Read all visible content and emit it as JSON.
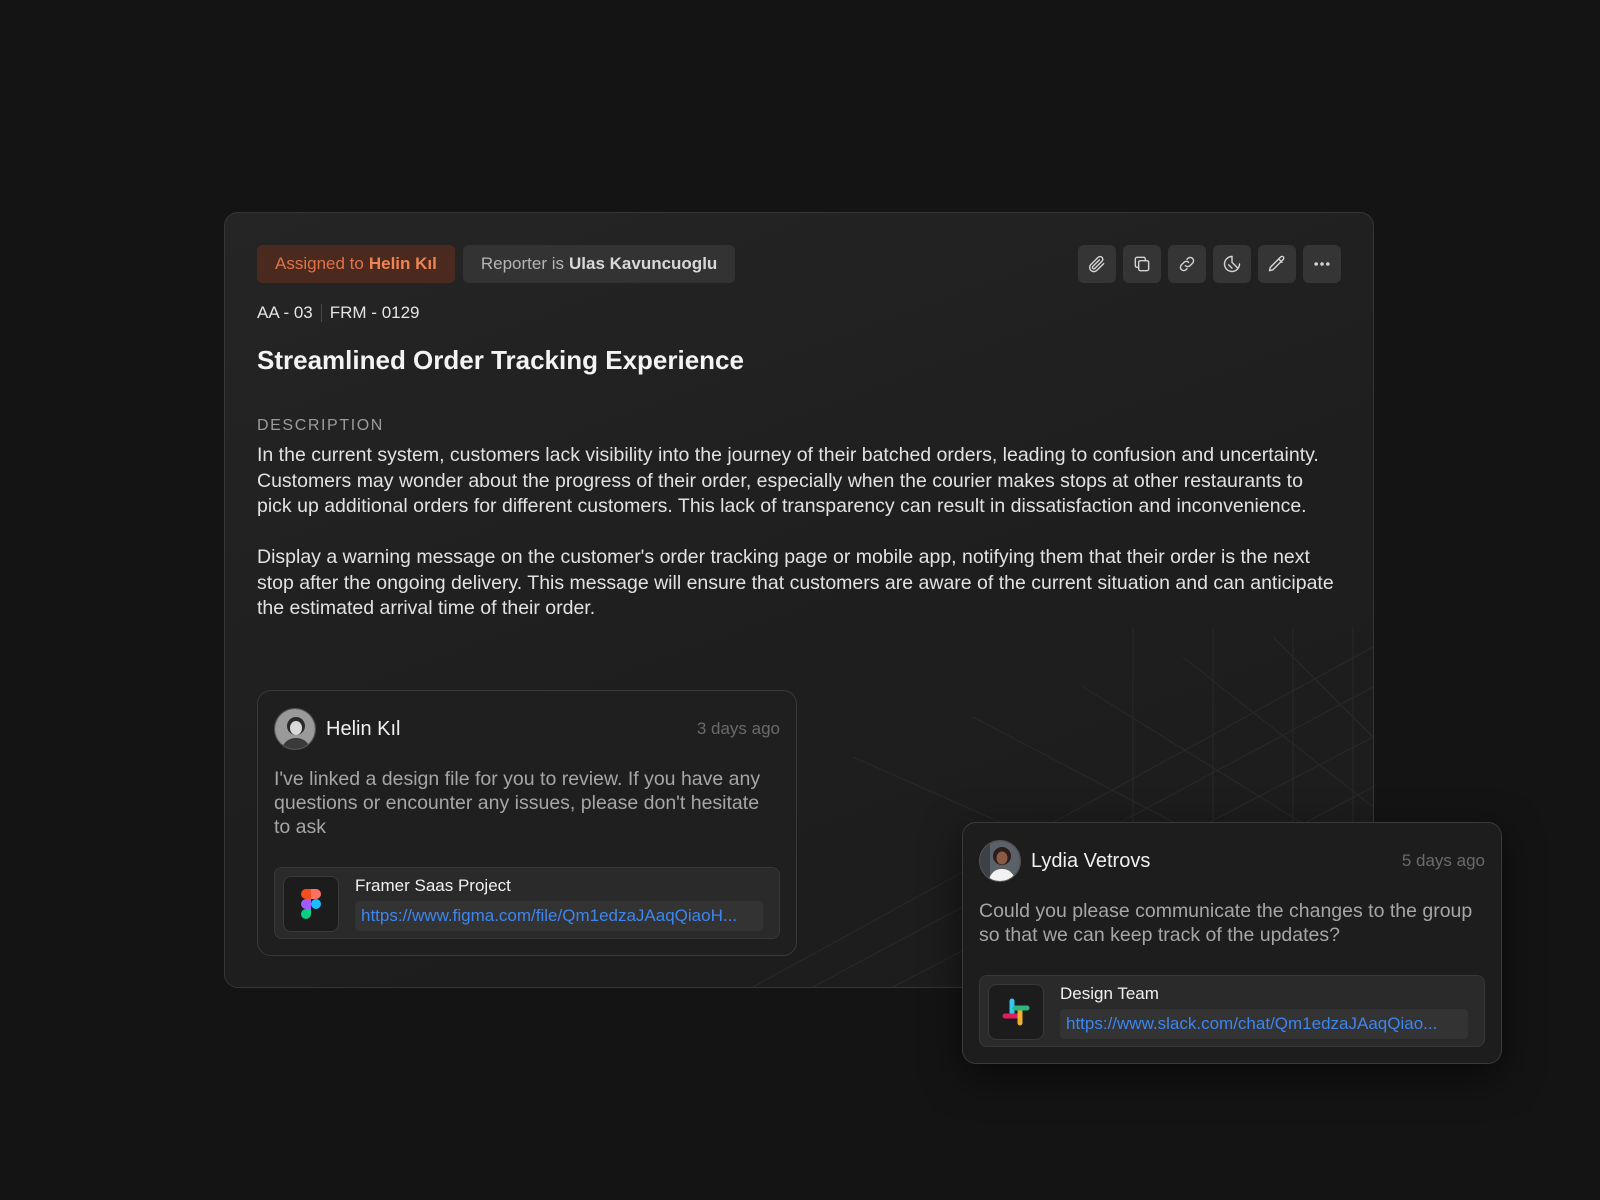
{
  "ticket": {
    "assigned_prefix": "Assigned to",
    "assignee": "Helin Kıl",
    "reporter_prefix": "Reporter is",
    "reporter": "Ulas Kavuncuoglu",
    "id_primary": "AA - 03",
    "id_secondary": "FRM - 0129",
    "title": "Streamlined Order Tracking Experience",
    "description_label": "DESCRIPTION",
    "description_p1": "In the current system, customers lack visibility into the journey of their batched orders, leading to confusion and uncertainty. Customers may wonder about the progress of their order, especially when the courier makes stops at other restaurants to pick up additional orders for different customers. This lack of transparency can result in dissatisfaction and inconvenience.",
    "description_p2": "Display a warning message on the customer's order tracking page or mobile app, notifying them that their order is the next stop after the ongoing delivery. This message will ensure that customers are aware of the current situation and can anticipate the estimated arrival time of their order.",
    "toolbar": [
      "paperclip-icon",
      "copy-icon",
      "link-icon",
      "tag-icon",
      "pencil-icon",
      "more-icon"
    ]
  },
  "comments": [
    {
      "author": "Helin Kıl",
      "time": "3 days ago",
      "body": "I've linked a design file for you to review. If you have any questions or encounter any issues, please don't hesitate to ask",
      "attachment": {
        "icon": "figma-icon",
        "title": "Framer Saas Project",
        "url": "https://www.figma.com/file/Qm1edzaJAaqQiaoH..."
      }
    },
    {
      "author": "Lydia Vetrovs",
      "time": "5 days ago",
      "body": "Could you please communicate the changes to the group so that we can keep track of the updates?",
      "attachment": {
        "icon": "slack-icon",
        "title": "Design Team",
        "url": "https://www.slack.com/chat/Qm1edzaJAaqQiao..."
      }
    }
  ],
  "colors": {
    "background": "#141414",
    "assigned_accent": "#f08354",
    "link": "#3d86f0"
  }
}
